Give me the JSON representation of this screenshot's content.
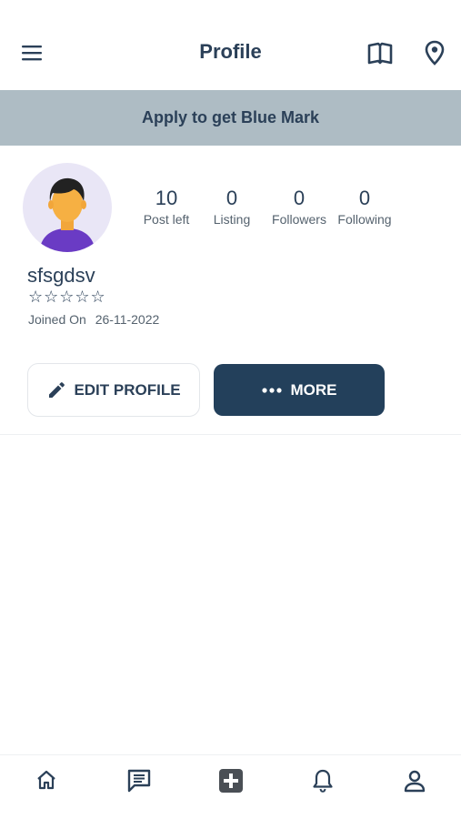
{
  "header": {
    "title": "Profile",
    "menu_icon": "hamburger-menu-icon",
    "map_icon": "map-book-icon",
    "location_icon": "location-pin-icon"
  },
  "banner": {
    "text": "Apply to get Blue Mark",
    "background": "#aebcc4"
  },
  "profile": {
    "avatar_icon": "user-avatar-icon",
    "username": "sfsgdsv",
    "rating_stars": "☆☆☆☆☆",
    "rating_value": 0,
    "joined_label": "Joined On",
    "joined_date": "26-11-2022"
  },
  "stats": [
    {
      "value": "10",
      "label": "Post left"
    },
    {
      "value": "0",
      "label": "Listing"
    },
    {
      "value": "0",
      "label": "Followers"
    },
    {
      "value": "0",
      "label": "Following"
    }
  ],
  "actions": {
    "edit_label": "EDIT PROFILE",
    "edit_icon": "pencil-icon",
    "more_label": "MORE",
    "more_icon": "ellipsis-icon",
    "more_background": "#23405b"
  },
  "bottom_nav": [
    {
      "icon": "home-icon"
    },
    {
      "icon": "chat-icon"
    },
    {
      "icon": "add-post-icon"
    },
    {
      "icon": "bell-icon"
    },
    {
      "icon": "profile-icon"
    }
  ],
  "colors": {
    "primary_text": "#2b4058",
    "secondary_text": "#55626e"
  }
}
